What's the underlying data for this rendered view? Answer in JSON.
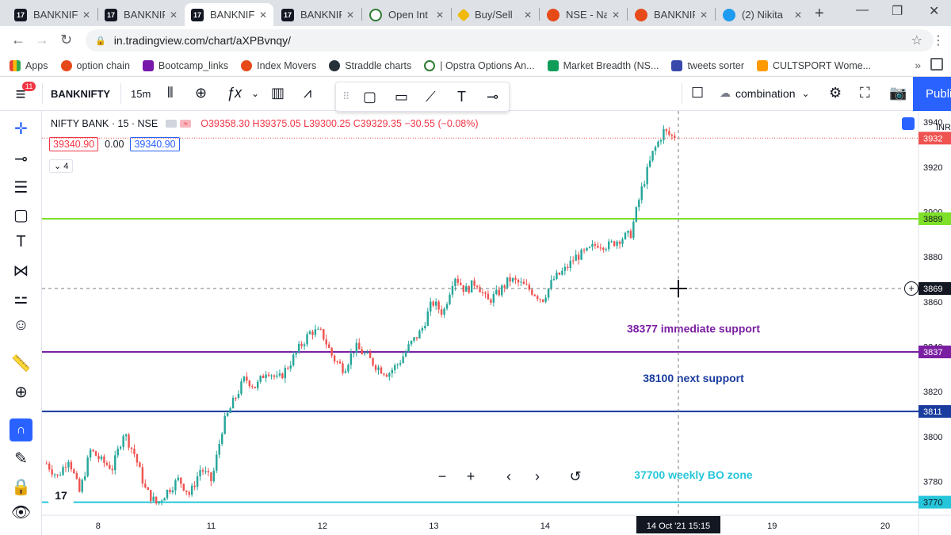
{
  "browser": {
    "tabs": [
      {
        "title": "BANKNIF",
        "active": false
      },
      {
        "title": "BANKNIF",
        "active": false
      },
      {
        "title": "BANKNIF",
        "active": true
      },
      {
        "title": "BANKNIF",
        "active": false
      },
      {
        "title": "Open Int",
        "active": false
      },
      {
        "title": "Buy/Sell",
        "active": false
      },
      {
        "title": "NSE - Na",
        "active": false
      },
      {
        "title": "BANKNIF",
        "active": false
      },
      {
        "title": "(2) Nikita",
        "active": false
      }
    ],
    "url": "in.tradingview.com/chart/aXPBvnqy/",
    "bookmarks": [
      "Apps",
      "option chain",
      "Bootcamp_links",
      "Index Movers",
      "Straddle charts",
      "| Opstra Options An...",
      "Market Breadth (NS...",
      "tweets sorter",
      "CULTSPORT Wome..."
    ]
  },
  "toolbar": {
    "notification_count": "11",
    "symbol": "BANKNIFTY",
    "interval": "15m",
    "layout_name": "combination",
    "publish_label": "Publi"
  },
  "legend": {
    "title": "NIFTY BANK · 15 · NSE",
    "ohlc": "O39358.30 H39375.05 L39300.25 C39329.35 −30.55 (−0.08%)",
    "bid": "39340.90",
    "spread": "0.00",
    "ask": "39340.90",
    "indicator_count": "4"
  },
  "chart_data": {
    "type": "candlestick",
    "symbol": "NIFTY BANK",
    "interval": "15",
    "exchange": "NSE",
    "x_labels": [
      {
        "label": "8",
        "pos": 0.064
      },
      {
        "label": "11",
        "pos": 0.193
      },
      {
        "label": "12",
        "pos": 0.32
      },
      {
        "label": "13",
        "pos": 0.447
      },
      {
        "label": "14",
        "pos": 0.574
      },
      {
        "label": "19",
        "pos": 0.833
      },
      {
        "label": "20",
        "pos": 0.962
      }
    ],
    "ylim": [
      37650,
      39450
    ],
    "y_ticks": [
      37800,
      38000,
      38200,
      38400,
      38600,
      38800,
      39000,
      39200,
      39400
    ],
    "y_tick_labels": [
      "3780",
      "3800",
      "3820",
      "3840",
      "3860",
      "3880",
      "3900",
      "3920",
      "3940"
    ],
    "current_price_label": "3932",
    "crosshair_price_label": "3869",
    "crosshair_time_label": "14 Oct '21  15:15",
    "currency_label": "INR",
    "horizontal_lines": [
      {
        "price": 38970,
        "color": "#7fe02a",
        "label": "3889"
      },
      {
        "price": 38377,
        "color": "#7b1fa2",
        "label": "3837"
      },
      {
        "price": 38112,
        "color": "#1a3c9e",
        "label": "3811"
      },
      {
        "price": 37708,
        "color": "#26c6da",
        "label": "3770"
      }
    ],
    "annotations": [
      {
        "text": "38377 immediate support",
        "color": "#7b1fa2",
        "price": 38482
      },
      {
        "text": "38100 next support",
        "color": "#1a3c9e",
        "price": 38260
      },
      {
        "text": "37700 weekly BO zone",
        "color": "#26c6da",
        "price": 37830
      }
    ],
    "close_path": [
      37880,
      37820,
      37905,
      37750,
      37940,
      37890,
      37860,
      38020,
      37920,
      37760,
      37700,
      37760,
      37810,
      37740,
      37860,
      37800,
      38050,
      38160,
      38260,
      38220,
      38300,
      38250,
      38320,
      38400,
      38470,
      38460,
      38350,
      38300,
      38400,
      38360,
      38310,
      38280,
      38330,
      38410,
      38470,
      38600,
      38550,
      38720,
      38650,
      38690,
      38600,
      38640,
      38700,
      38680,
      38650,
      38610,
      38700,
      38740,
      38800,
      38820,
      38860,
      38850,
      38880,
      38900,
      39100,
      39260,
      39360,
      39329
    ]
  }
}
